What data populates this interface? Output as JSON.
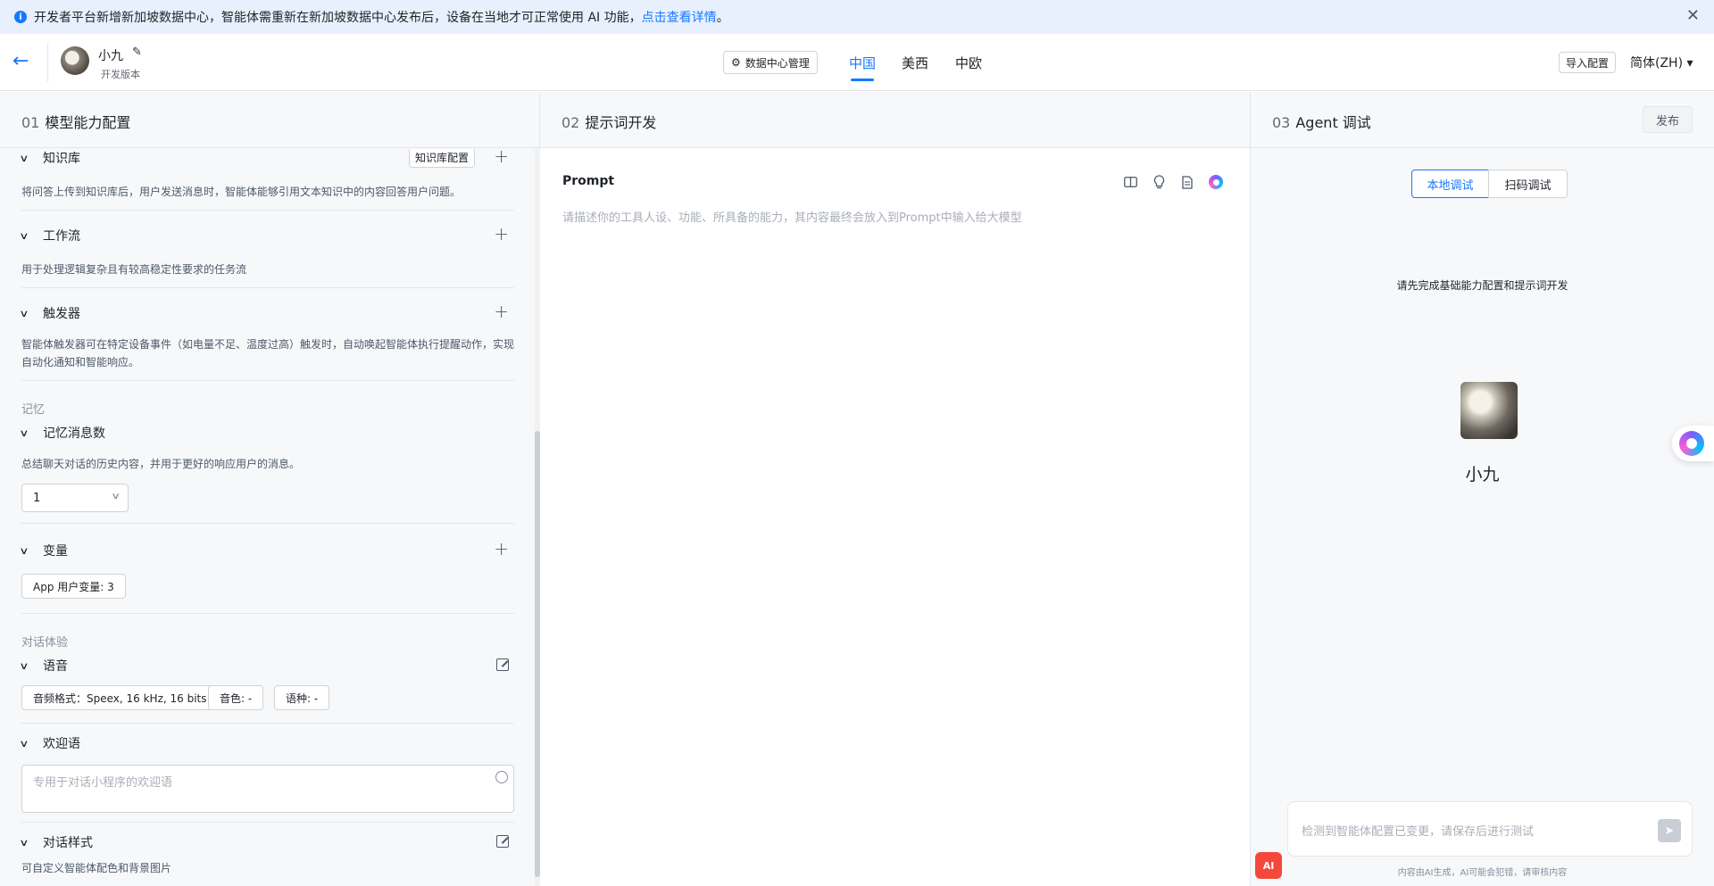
{
  "banner": {
    "text": "开发者平台新增新加坡数据中心，智能体需重新在新加坡数据中心发布后，设备在当地才可正常使用 AI 功能，",
    "link": "点击查看详情",
    "suffix": "。",
    "info_glyph": "i",
    "close_glyph": "✕"
  },
  "header": {
    "back_glyph": "←",
    "agent_name": "小九",
    "edit_glyph": "✎",
    "version": "开发版本",
    "dc_button": "数据中心管理",
    "dc_icon": "⚙",
    "regions": [
      "中国",
      "美西",
      "中欧"
    ],
    "active_region": "中国",
    "import_button": "导入配置",
    "language": "简体(ZH) ▾"
  },
  "col1": {
    "num": "01",
    "title": "模型能力配置",
    "knowledge": {
      "title": "知识库",
      "config_button": "知识库配置",
      "desc": "将问答上传到知识库后，用户发送消息时，智能体能够引用文本知识中的内容回答用户问题。"
    },
    "workflow": {
      "title": "工作流",
      "desc": "用于处理逻辑复杂且有较高稳定性要求的任务流"
    },
    "trigger": {
      "title": "触发器",
      "desc": "智能体触发器可在特定设备事件（如电量不足、温度过高）触发时，自动唤起智能体执行提醒动作，实现自动化通知和智能响应。"
    },
    "memory_group": "记忆",
    "memory_count": {
      "title": "记忆消息数",
      "desc": "总结聊天对话的历史内容，并用于更好的响应用户的消息。",
      "value": "1"
    },
    "variables": {
      "title": "变量",
      "tag": "App 用户变量: 3"
    },
    "dialog_group": "对话体验",
    "voice": {
      "title": "语音",
      "tags": [
        "音频格式：Speex, 16 kHz, 16 bits",
        "音色: -",
        "语种: -"
      ]
    },
    "welcome": {
      "title": "欢迎语",
      "placeholder": "专用于对话小程序的欢迎语"
    },
    "style": {
      "title": "对话样式",
      "desc": "可自定义智能体配色和背景图片"
    },
    "chevron_glyph": "∨",
    "plus_glyph": "+"
  },
  "col2": {
    "num": "02",
    "title": "提示词开发",
    "prompt_label": "Prompt",
    "prompt_placeholder": "请描述你的工具人设、功能、所具备的能力，其内容最终会放入到Prompt中输入给大模型",
    "icons": [
      "split-view-icon",
      "lightbulb-icon",
      "document-icon",
      "ai-assistant-icon"
    ]
  },
  "col3": {
    "num": "03",
    "title": "Agent 调试",
    "publish_button": "发布",
    "tabs": [
      "本地调试",
      "扫码调试"
    ],
    "active_tab": "本地调试",
    "notice": "请先完成基础能力配置和提示词开发",
    "agent_name": "小九",
    "chat_placeholder": "检测到智能体配置已变更，请保存后进行测试",
    "send_glyph": "➤",
    "ai_badge": "AI",
    "footnote": "内容由AI生成，AI可能会犯错，请审核内容"
  }
}
